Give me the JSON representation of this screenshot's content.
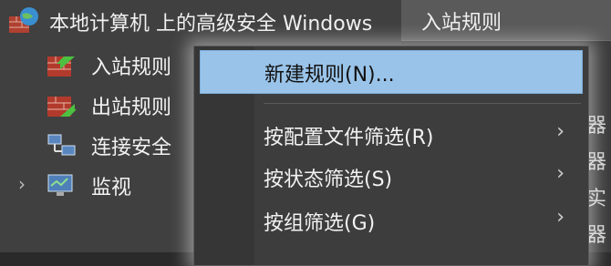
{
  "tree": {
    "root_label": "本地计算机 上的高级安全 Windows",
    "items": [
      {
        "label": "入站规则",
        "icon": "inbound-rules-icon"
      },
      {
        "label": "出站规则",
        "icon": "outbound-rules-icon"
      },
      {
        "label": "连接安全",
        "icon": "connection-security-icon"
      },
      {
        "label": "监视",
        "icon": "monitor-icon",
        "expander": "›"
      }
    ]
  },
  "right_pane": {
    "header": "入站规则",
    "edge_texts": [
      "器",
      "器",
      "实",
      "器"
    ]
  },
  "context_menu": {
    "items": [
      {
        "label": "新建规则(N)...",
        "highlighted": true,
        "has_submenu": false
      },
      {
        "label": "按配置文件筛选(R)",
        "highlighted": false,
        "has_submenu": true
      },
      {
        "label": "按状态筛选(S)",
        "highlighted": false,
        "has_submenu": true
      },
      {
        "label": "按组筛选(G)",
        "highlighted": false,
        "has_submenu": true
      }
    ],
    "submenu_arrow": "›"
  },
  "colors": {
    "highlight": "#99c3e8",
    "background": "#404040"
  }
}
